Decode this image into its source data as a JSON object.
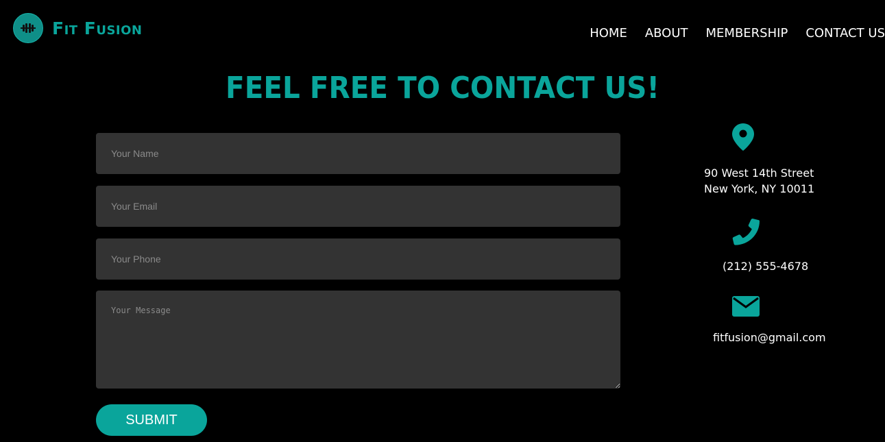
{
  "brand": {
    "name": "Fit Fusion",
    "logo_icon": "dumbbell-icon"
  },
  "nav": {
    "items": [
      {
        "label": "HOME"
      },
      {
        "label": "ABOUT"
      },
      {
        "label": "MEMBERSHIP"
      },
      {
        "label": "CONTACT US"
      }
    ]
  },
  "contact": {
    "heading": "FEEL FREE TO CONTACT US!",
    "form": {
      "name_placeholder": "Your Name",
      "email_placeholder": "Your Email",
      "phone_placeholder": "Your Phone",
      "message_placeholder": "Your Message",
      "name_value": "",
      "email_value": "",
      "phone_value": "",
      "message_value": "",
      "submit_label": "SUBMIT"
    },
    "info": {
      "address_line1": "90 West 14th Street",
      "address_line2": "New York, NY 10011",
      "address_icon": "location-pin-icon",
      "phone": "(212) 555-4678",
      "phone_icon": "phone-icon",
      "email": "fitfusion@gmail.com",
      "email_icon": "envelope-icon"
    }
  },
  "colors": {
    "accent": "#0aa59b",
    "background": "#000000",
    "field": "#333333",
    "text": "#ffffff"
  }
}
